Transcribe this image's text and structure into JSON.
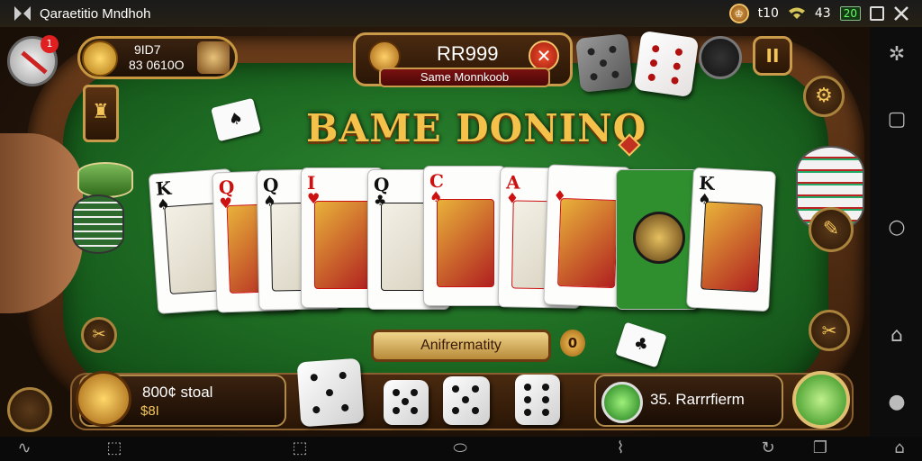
{
  "status_bar": {
    "app_title": "Qaraetitio Mndhoh",
    "badge_text": "♔",
    "time": "t10",
    "signal": "43",
    "battery": "20"
  },
  "player": {
    "line1": "9ID7",
    "line2": "83 0610O",
    "notification_count": "1"
  },
  "jackpot": {
    "value": "RR999",
    "subtitle": "Same Monnkoob"
  },
  "game_title": "BAME DONINO",
  "cards": [
    {
      "rank": "K",
      "suit": "♠",
      "color": "#111111"
    },
    {
      "rank": "Q",
      "suit": "♥",
      "color": "#cc1111"
    },
    {
      "rank": "Q",
      "suit": "♠",
      "color": "#111111"
    },
    {
      "rank": "I",
      "suit": "♥",
      "color": "#cc1111"
    },
    {
      "rank": "Q",
      "suit": "♣",
      "color": "#111111"
    },
    {
      "rank": "C",
      "suit": "♠",
      "color": "#cc1111"
    },
    {
      "rank": "A",
      "suit": "♦",
      "color": "#cc1111"
    },
    {
      "rank": "",
      "suit": "♦",
      "color": "#cc1111"
    },
    {
      "rank": "",
      "suit": "",
      "color": "#2f8f2f"
    },
    {
      "rank": "K",
      "suit": "♠",
      "color": "#111111"
    }
  ],
  "action_button": "Anifrermatity",
  "hint_badge": "0",
  "bottom_left": {
    "line1": "800¢ stoal",
    "line2": "$8I"
  },
  "bottom_right": {
    "label": "35. Rarrrfierm"
  },
  "colors": {
    "felt": "#2f8a33",
    "gold": "#f4c24a",
    "wood": "#6a3c1a",
    "accent_red": "#e02020"
  },
  "icons": {
    "rightnav": [
      "settings-icon",
      "square-icon",
      "circle-icon",
      "home-icon",
      "location-icon"
    ],
    "bottomnav": [
      "wave-icon",
      "back-icon",
      "crop-icon",
      "home-pill-icon",
      "chart-icon",
      "refresh-icon",
      "windows-icon",
      "store-icon"
    ]
  }
}
